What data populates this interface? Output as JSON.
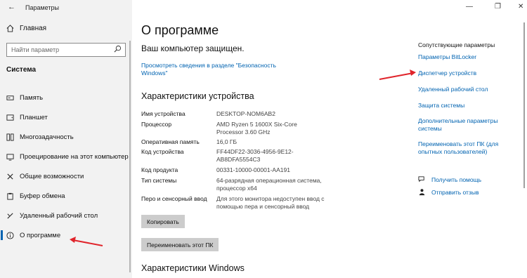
{
  "window": {
    "title": "Параметры"
  },
  "sidebar": {
    "home_label": "Главная",
    "search_placeholder": "Найти параметр",
    "section_title": "Система",
    "items": [
      {
        "label": "Память",
        "icon": "storage-icon"
      },
      {
        "label": "Планшет",
        "icon": "tablet-icon"
      },
      {
        "label": "Многозадачность",
        "icon": "multitasking-icon"
      },
      {
        "label": "Проецирование на этот компьютер",
        "icon": "projecting-icon"
      },
      {
        "label": "Общие возможности",
        "icon": "shared-experiences-icon"
      },
      {
        "label": "Буфер обмена",
        "icon": "clipboard-icon"
      },
      {
        "label": "Удаленный рабочий стол",
        "icon": "remote-desktop-icon"
      },
      {
        "label": "О программе",
        "icon": "info-icon",
        "active": true
      }
    ]
  },
  "main": {
    "title": "О программе",
    "protected_text": "Ваш компьютер защищен.",
    "protected_link": "Просмотреть сведения в разделе \"Безопасность Windows\"",
    "device_specs_title": "Характеристики устройства",
    "specs": [
      {
        "key": "Имя устройства",
        "value": "DESKTOP-NOM6AB2"
      },
      {
        "key": "Процессор",
        "value": "AMD Ryzen 5 1600X Six-Core Processor 3.60 GHz"
      },
      {
        "key": "Оперативная память",
        "value": "16,0 ГБ"
      },
      {
        "key": "Код устройства",
        "value": "FF44DF22-3036-4956-9E12-AB8DFA5554C3"
      },
      {
        "key": "Код продукта",
        "value": "00331-10000-00001-AA191"
      },
      {
        "key": "Тип системы",
        "value": "64-разрядная операционная система, процессор x64"
      },
      {
        "key": "Перо и сенсорный ввод",
        "value": "Для этого монитора недоступен ввод с помощью пера и сенсорный ввод"
      }
    ],
    "copy_button": "Копировать",
    "rename_button": "Переименовать этот ПК",
    "windows_specs_title": "Характеристики Windows"
  },
  "related": {
    "title": "Сопутствующие параметры",
    "links": [
      "Параметры BitLocker",
      "Диспетчер устройств",
      "Удаленный рабочий стол",
      "Защита системы",
      "Дополнительные параметры системы",
      "Переименовать этот ПК (для опытных пользователей)"
    ],
    "help_label": "Получить помощь",
    "feedback_label": "Отправить отзыв"
  },
  "colors": {
    "accent": "#0063b1",
    "annotation_arrow": "#e0242b",
    "sidebar_bg": "#f2f2f2",
    "button_bg": "#cccccc"
  }
}
